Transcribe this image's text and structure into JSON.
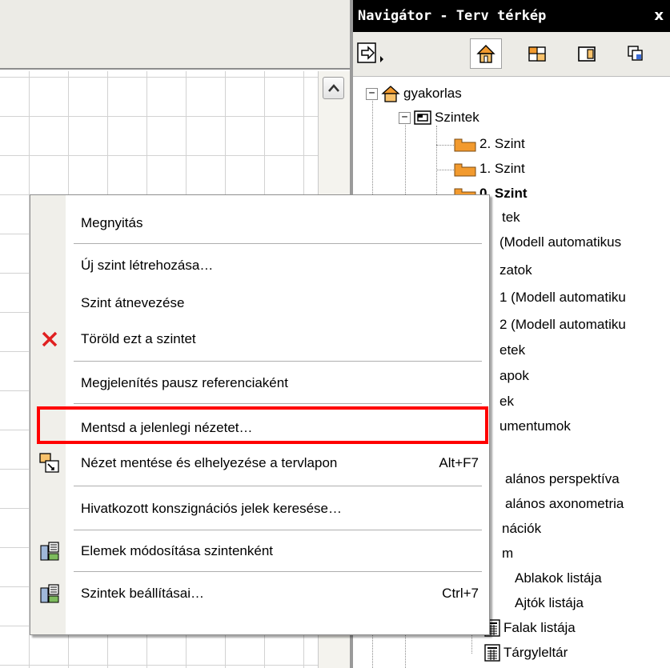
{
  "navigator": {
    "title": "Navigátor - Terv térkép",
    "close": "x"
  },
  "tree": [
    {
      "label": "gyakorlas",
      "bold": false
    },
    {
      "label": "Szintek",
      "bold": false
    },
    {
      "label": "2. Szint",
      "bold": false
    },
    {
      "label": "1. Szint",
      "bold": false
    },
    {
      "label": "0. Szint",
      "bold": true
    },
    {
      "label": "tek",
      "bold": false
    },
    {
      "label": "(Modell automatikus",
      "bold": false
    },
    {
      "label": "zatok",
      "bold": false
    },
    {
      "label": "1 (Modell automatiku",
      "bold": false
    },
    {
      "label": "2 (Modell automatiku",
      "bold": false
    },
    {
      "label": "etek",
      "bold": false
    },
    {
      "label": "apok",
      "bold": false
    },
    {
      "label": "ek",
      "bold": false
    },
    {
      "label": "umentumok",
      "bold": false
    },
    {
      "label": "",
      "bold": false
    },
    {
      "label": "alános perspektíva",
      "bold": false
    },
    {
      "label": "alános axonometria",
      "bold": false
    },
    {
      "label": "nációk",
      "bold": false
    },
    {
      "label": "m",
      "bold": false
    },
    {
      "label": "Ablakok listája",
      "bold": false
    },
    {
      "label": "Ajtók listája",
      "bold": false
    },
    {
      "label": "Falak listája",
      "bold": false
    },
    {
      "label": "Tárgyleltár",
      "bold": false
    }
  ],
  "context_menu": {
    "items": [
      {
        "label": "Megnyitás",
        "icon": "",
        "shortcut": ""
      },
      {
        "label": "Új szint létrehozása…",
        "icon": "",
        "shortcut": ""
      },
      {
        "label": "Szint átnevezése",
        "icon": "",
        "shortcut": ""
      },
      {
        "label": "Töröld ezt a szintet",
        "icon": "delete-x-icon",
        "shortcut": ""
      },
      {
        "label": "Megjelenítés pausz referenciaként",
        "icon": "",
        "shortcut": ""
      },
      {
        "label": "Mentsd a jelenlegi nézetet…",
        "icon": "",
        "shortcut": ""
      },
      {
        "label": "Nézet mentése és elhelyezése a tervlapon",
        "icon": "save-place-view-icon",
        "shortcut": "Alt+F7"
      },
      {
        "label": "Hivatkozott konszignációs jelek keresése…",
        "icon": "",
        "shortcut": ""
      },
      {
        "label": "Elemek módosítása szintenként",
        "icon": "story-elements-icon",
        "shortcut": ""
      },
      {
        "label": "Szintek beállításai…",
        "icon": "story-settings-icon",
        "shortcut": "Ctrl+7"
      }
    ]
  },
  "colors": {
    "highlight": "#ff0000",
    "title_bar": "#000000",
    "folder_orange": "#f29a2e"
  }
}
